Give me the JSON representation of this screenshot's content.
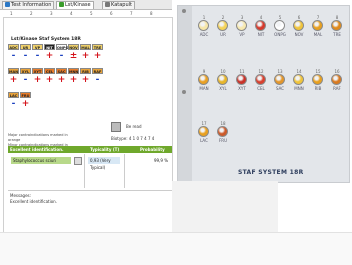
{
  "tabs": [
    {
      "label": "Test Information",
      "icon": "info-icon",
      "color": "#2b78c6"
    },
    {
      "label": "Lst/Kinase",
      "icon": "grid-icon",
      "color": "#3a9d2c"
    },
    {
      "label": "Katapult",
      "icon": "chart-icon",
      "color": "#777777"
    }
  ],
  "column_numbers": [
    "1",
    "2",
    "3",
    "4",
    "5",
    "6",
    "7",
    "8"
  ],
  "panel": {
    "title": "Lst/Kinase Staf System 18R",
    "rows": [
      {
        "cells": [
          {
            "label": "ADC",
            "color": "#f0d16b"
          },
          {
            "label": "UR",
            "color": "#f0d16b"
          },
          {
            "label": "VP",
            "color": "#f0d16b"
          },
          {
            "label": "NIT",
            "color": "#222222"
          },
          {
            "label": "ONPG",
            "color": "#ffffff"
          },
          {
            "label": "NOV",
            "color": "#f0d16b"
          },
          {
            "label": "MAL",
            "color": "#f0d16b"
          },
          {
            "label": "TRE",
            "color": "#f0d16b"
          }
        ],
        "signs": [
          "-",
          "-",
          "-",
          "+",
          "-",
          "±",
          "+",
          "+"
        ]
      },
      {
        "cells": [
          {
            "label": "MAN",
            "color": "#e8a23a"
          },
          {
            "label": "XYL",
            "color": "#e8a23a"
          },
          {
            "label": "XYT",
            "color": "#e87c2a"
          },
          {
            "label": "CEL",
            "color": "#e87c2a"
          },
          {
            "label": "SAC",
            "color": "#e87c2a"
          },
          {
            "label": "MNN",
            "color": "#e87c2a"
          },
          {
            "label": "RIB",
            "color": "#e8a23a"
          },
          {
            "label": "RAF",
            "color": "#e8a23a"
          }
        ],
        "signs": [
          "+",
          "-",
          "+",
          "+",
          "+",
          "+",
          "+",
          "-"
        ]
      },
      {
        "cells": [
          {
            "label": "LAC",
            "color": "#e8a23a"
          },
          {
            "label": "FRU",
            "color": "#e87c2a"
          }
        ],
        "signs": [
          "-",
          "+"
        ]
      }
    ],
    "note1": "Major contraindications marked in orange",
    "note2": "Minor contraindications marked in yellow",
    "read_label": "Be read",
    "code_label": "Biotype: 4 1 0 7 4 7 4"
  },
  "identification": {
    "header_name": "Excellent identification.",
    "header_typicality": "Typicality (T)",
    "header_probability": "Probability",
    "name": "Staphylococcus sciuri",
    "typicality": "0,93 (Very Typical)",
    "probability": "99,9 %"
  },
  "messages": {
    "label": "Messages:",
    "text": "Excellent identification."
  },
  "strip": {
    "label": "STAF SYSTEM 18R",
    "wells": [
      {
        "num": "1",
        "name": "ADC",
        "color": "#f6e6a8"
      },
      {
        "num": "2",
        "name": "UR",
        "color": "#f4d35a"
      },
      {
        "num": "3",
        "name": "VP",
        "color": "#f7e9b0"
      },
      {
        "num": "4",
        "name": "NIT",
        "color": "#d63a2c"
      },
      {
        "num": "5",
        "name": "ONPG",
        "color": "#ffffff"
      },
      {
        "num": "6",
        "name": "NOV",
        "color": "#f0c43b"
      },
      {
        "num": "7",
        "name": "MAL",
        "color": "#e8a020"
      },
      {
        "num": "8",
        "name": "TRE",
        "color": "#e08a1c"
      },
      {
        "num": "9",
        "name": "MAN",
        "color": "#e9a024"
      },
      {
        "num": "10",
        "name": "XYL",
        "color": "#e7b52a"
      },
      {
        "num": "11",
        "name": "XYT",
        "color": "#c9332a"
      },
      {
        "num": "12",
        "name": "CEL",
        "color": "#d8402f"
      },
      {
        "num": "13",
        "name": "SAC",
        "color": "#e3962a"
      },
      {
        "num": "14",
        "name": "MNN",
        "color": "#f0c43b"
      },
      {
        "num": "15",
        "name": "RIB",
        "color": "#e8a020"
      },
      {
        "num": "16",
        "name": "RAF",
        "color": "#d97a22"
      },
      {
        "num": "17",
        "name": "LAC",
        "color": "#e8a020"
      },
      {
        "num": "18",
        "name": "FRU",
        "color": "#cc5a2a"
      }
    ]
  }
}
